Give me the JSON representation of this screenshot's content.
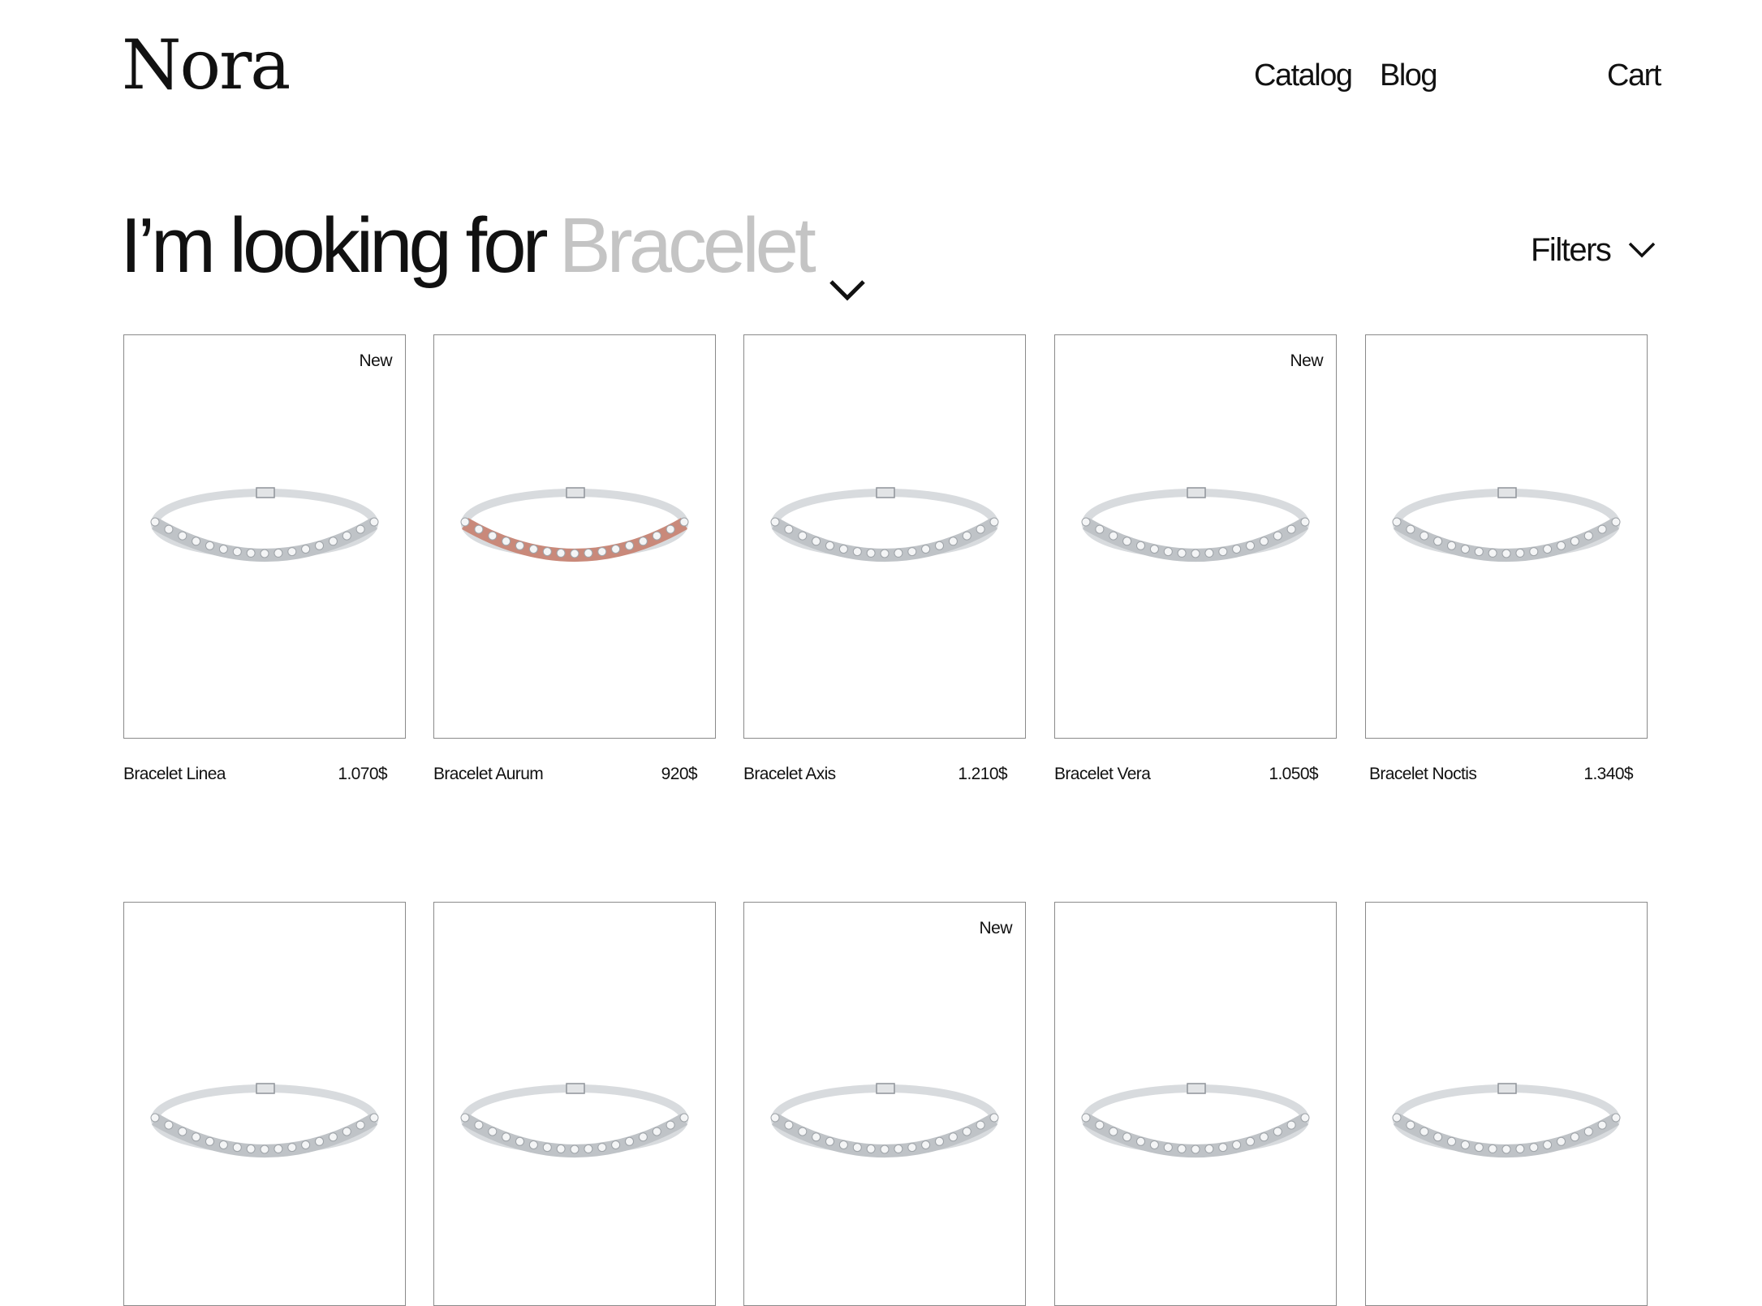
{
  "header": {
    "logo": "Nora",
    "nav": {
      "catalog": "Catalog",
      "blog": "Blog",
      "cart": "Cart"
    }
  },
  "search": {
    "prefix": "I’m looking for",
    "category": "Bracelet",
    "category_icon": "chevron-down-icon",
    "filters_label": "Filters",
    "filters_icon": "chevron-down-icon"
  },
  "products": [
    {
      "name": "Bracelet Linea",
      "price": "1.070$",
      "badge": "New",
      "metal": "silver"
    },
    {
      "name": "Bracelet Aurum",
      "price": "920$",
      "badge": "",
      "metal": "rose-gold"
    },
    {
      "name": "Bracelet Axis",
      "price": "1.210$",
      "badge": "",
      "metal": "silver"
    },
    {
      "name": "Bracelet Vera",
      "price": "1.050$",
      "badge": "New",
      "metal": "silver"
    },
    {
      "name": "Bracelet Noctis",
      "price": "1.340$",
      "badge": "",
      "metal": "silver"
    },
    {
      "badge": "",
      "metal": "silver"
    },
    {
      "badge": "",
      "metal": "silver"
    },
    {
      "badge": "New",
      "metal": "silver"
    },
    {
      "badge": "",
      "metal": "silver"
    },
    {
      "badge": "",
      "metal": "silver"
    }
  ],
  "colors": {
    "text": "#111111",
    "muted": "#c4c4c4",
    "card_border": "#8a8a8a",
    "silver": "#bfc3c7",
    "rose_gold": "#c9897a"
  }
}
